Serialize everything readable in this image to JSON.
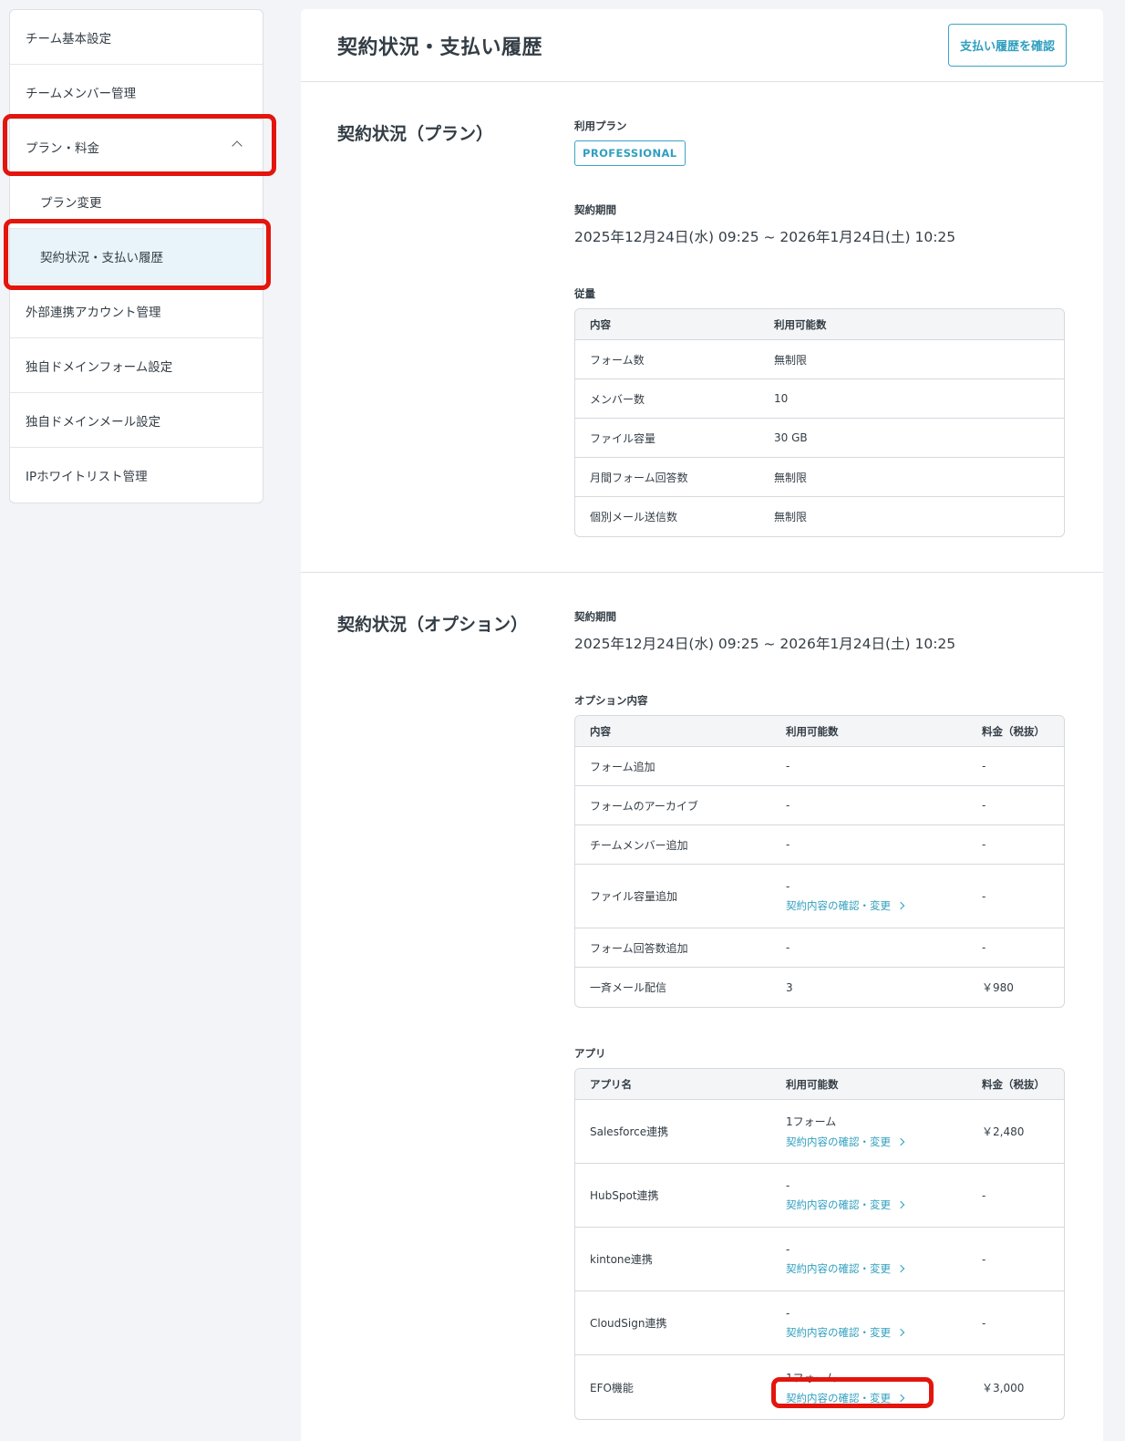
{
  "sidebar": {
    "items": [
      {
        "label": "チーム基本設定"
      },
      {
        "label": "チームメンバー管理"
      },
      {
        "label": "プラン・料金"
      },
      {
        "label": "プラン変更"
      },
      {
        "label": "契約状況・支払い履歴"
      },
      {
        "label": "外部連携アカウント管理"
      },
      {
        "label": "独自ドメインフォーム設定"
      },
      {
        "label": "独自ドメインメール設定"
      },
      {
        "label": "IPホワイトリスト管理"
      }
    ]
  },
  "header": {
    "title": "契約状況・支払い履歴",
    "history_button": "支払い履歴を確認"
  },
  "plan_section": {
    "title": "契約状況（プラン）",
    "plan_label": "利用プラン",
    "plan_name": "PROFESSIONAL",
    "period_label": "契約期間",
    "period": "2025年12月24日(水) 09:25 ~ 2026年1月24日(土) 10:25",
    "usage_label": "従量",
    "usage_headers": [
      "内容",
      "利用可能数"
    ],
    "usage_rows": [
      [
        "フォーム数",
        "無制限"
      ],
      [
        "メンバー数",
        "10"
      ],
      [
        "ファイル容量",
        "30 GB"
      ],
      [
        "月間フォーム回答数",
        "無制限"
      ],
      [
        "個別メール送信数",
        "無制限"
      ]
    ]
  },
  "option_section": {
    "title": "契約状況（オプション）",
    "period_label": "契約期間",
    "period": "2025年12月24日(水) 09:25 ~ 2026年1月24日(土) 10:25",
    "options_label": "オプション内容",
    "options_headers": [
      "内容",
      "利用可能数",
      "料金（税抜）"
    ],
    "options_rows": [
      {
        "name": "フォーム追加",
        "qty": "-",
        "price": "-"
      },
      {
        "name": "フォームのアーカイブ",
        "qty": "-",
        "price": "-"
      },
      {
        "name": "チームメンバー追加",
        "qty": "-",
        "price": "-"
      },
      {
        "name": "ファイル容量追加",
        "qty": "-",
        "price": "-",
        "link": "契約内容の確認・変更"
      },
      {
        "name": "フォーム回答数追加",
        "qty": "-",
        "price": "-"
      },
      {
        "name": "一斉メール配信",
        "qty": "3",
        "price": "￥980"
      }
    ],
    "apps_label": "アプリ",
    "apps_headers": [
      "アプリ名",
      "利用可能数",
      "料金（税抜）"
    ],
    "apps_rows": [
      {
        "name": "Salesforce連携",
        "qty": "1フォーム",
        "price": "￥2,480",
        "link": "契約内容の確認・変更"
      },
      {
        "name": "HubSpot連携",
        "qty": "-",
        "price": "-",
        "link": "契約内容の確認・変更"
      },
      {
        "name": "kintone連携",
        "qty": "-",
        "price": "-",
        "link": "契約内容の確認・変更"
      },
      {
        "name": "CloudSign連携",
        "qty": "-",
        "price": "-",
        "link": "契約内容の確認・変更"
      },
      {
        "name": "EFO機能",
        "qty": "1フォーム",
        "price": "￥3,000",
        "link": "契約内容の確認・変更"
      }
    ]
  },
  "colors": {
    "accent": "#2f9fbf",
    "highlight": "#e3150d",
    "active_bg": "#e9f4fa"
  }
}
